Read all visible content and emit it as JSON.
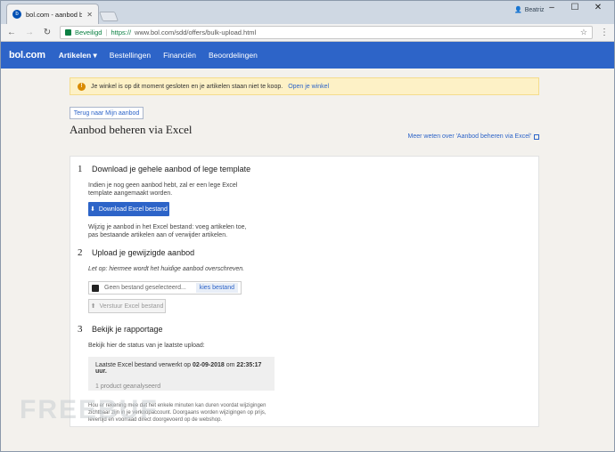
{
  "browser": {
    "tab_title": "bol.com - aanbod behere",
    "profile_name": "Beatriz",
    "secure_label": "Beveiligd",
    "url_scheme": "https://",
    "url_rest": "www.bol.com/sdd/offers/bulk-upload.html"
  },
  "site": {
    "logo": "bol.com",
    "nav": [
      "Artikelen",
      "Bestellingen",
      "Financiën",
      "Beoordelingen"
    ]
  },
  "page": {
    "alert_text": "Je winkel is op dit moment gesloten en je artikelen staan niet te koop.",
    "alert_link": "Open je winkel",
    "back_button": "Terug naar Mijn aanbod",
    "title": "Aanbod beheren via Excel",
    "help_link": "Meer weten over 'Aanbod beheren via Excel'"
  },
  "steps": {
    "s1_num": "1",
    "s1_title": "Download je gehele aanbod of lege template",
    "s1_text1": "Indien je nog geen aanbod hebt, zal er een lege Excel",
    "s1_text2": "template aangemaakt worden.",
    "s1_button": "Download Excel bestand",
    "s1_text3": "Wijzig je aanbod in het Excel bestand: voeg artikelen toe,",
    "s1_text4": "pas bestaande artikelen aan of verwijder artikelen.",
    "s2_num": "2",
    "s2_title": "Upload je gewijzigde aanbod",
    "s2_note": "Let op: hiermee wordt het huidige aanbod overschreven.",
    "s2_file_placeholder": "Geen bestand geselecteerd...",
    "s2_file_button": "kies bestand",
    "s2_submit": "Verstuur Excel bestand",
    "s3_num": "3",
    "s3_title": "Bekijk je rapportage",
    "s3_text": "Bekijk hier de status van je laatste upload:",
    "s3_status_prefix": "Laatste Excel bestand verwerkt op",
    "s3_date": "02-09-2018",
    "s3_om": "om",
    "s3_time": "22:35:17",
    "s3_uur": "uur.",
    "s3_processed": "1 product geanalyseerd",
    "foot1": "Hou er rekening mee dat het enkele minuten kan duren voordat wijzigingen",
    "foot2": "zichtbaar zijn in je verkoopaccount. Doorgaans worden wijzigingen op prijs,",
    "foot3": "levertijd en voorraad direct doorgevoerd op de webshop."
  },
  "watermark": "FREEBUF"
}
